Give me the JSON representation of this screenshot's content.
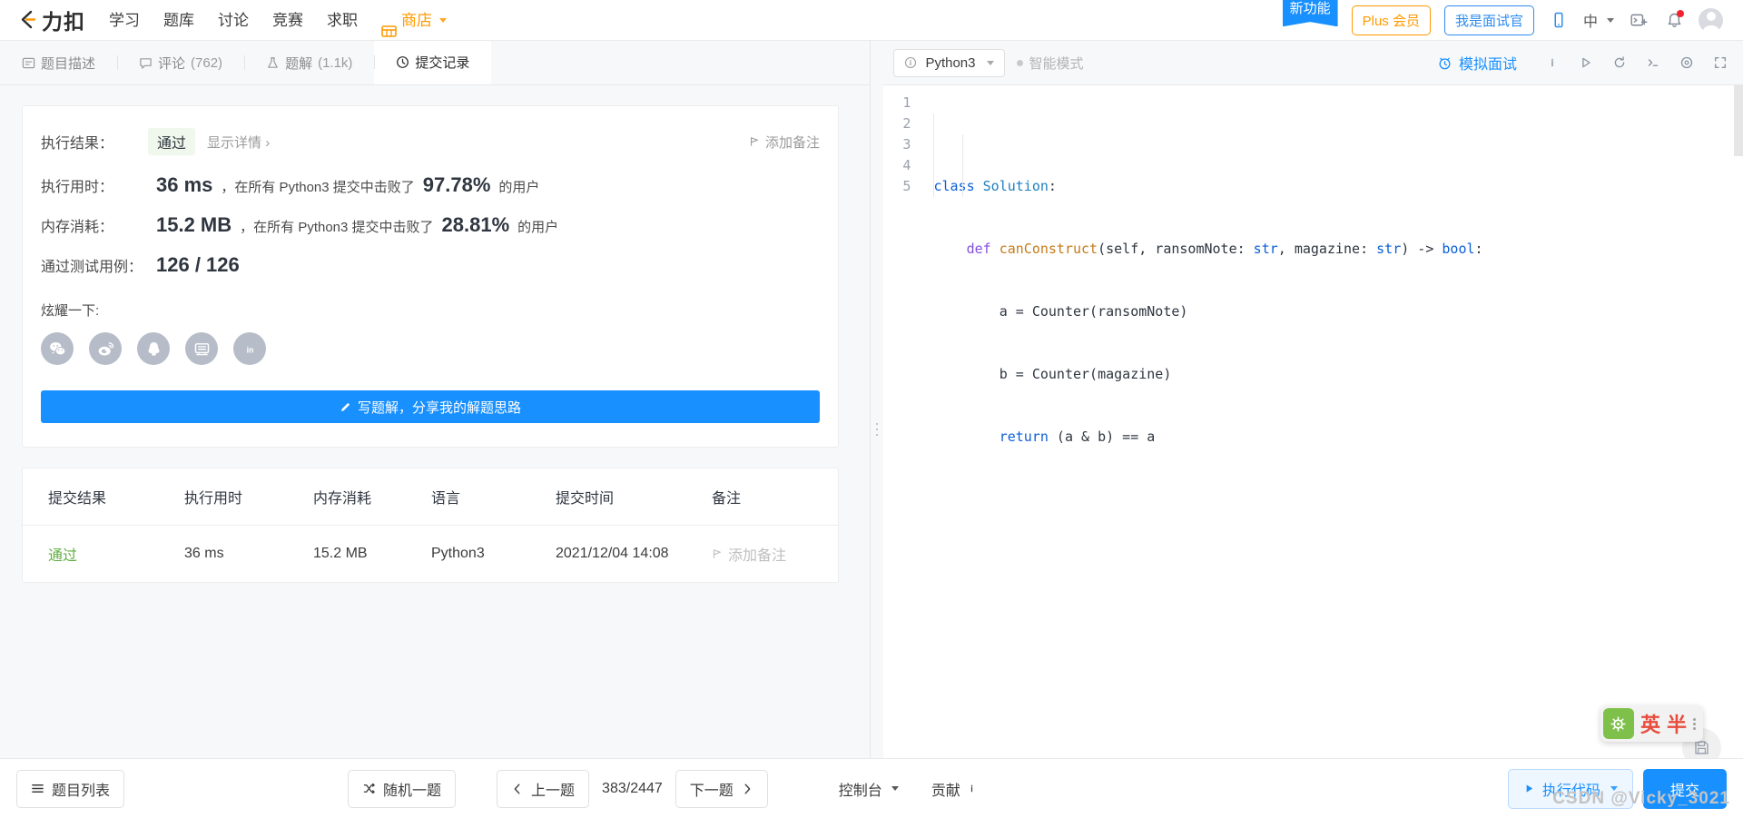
{
  "nav": {
    "brand": "力扣",
    "links": [
      "学习",
      "题库",
      "讨论",
      "竞赛",
      "求职"
    ],
    "shop": "商店",
    "ribbon": "新功能",
    "plus": "Plus 会员",
    "interviewer": "我是面试官",
    "lang": "中",
    "icons": {
      "mobile": "mobile-icon",
      "terminal": "terminal-add-icon",
      "bell": "notification-bell-icon",
      "avatar": "user-avatar"
    }
  },
  "tabs": [
    {
      "label": "题目描述",
      "count": "",
      "icon": "description-icon",
      "active": false
    },
    {
      "label": "评论",
      "count": "(762)",
      "icon": "comment-icon",
      "active": false
    },
    {
      "label": "题解",
      "count": "(1.1k)",
      "icon": "flask-icon",
      "active": false
    },
    {
      "label": "提交记录",
      "count": "",
      "icon": "clock-icon",
      "active": true
    }
  ],
  "result": {
    "exec_label": "执行结果：",
    "status": "通过",
    "detail_link": "显示详情",
    "add_note": "添加备注",
    "runtime_label": "执行用时：",
    "runtime_value": "36 ms",
    "runtime_mid": "，在所有 Python3 提交中击败了",
    "runtime_percent": "97.78%",
    "runtime_suffix": "的用户",
    "memory_label": "内存消耗：",
    "memory_value": "15.2 MB",
    "memory_mid": "，在所有 Python3 提交中击败了",
    "memory_percent": "28.81%",
    "memory_suffix": "的用户",
    "cases_label": "通过测试用例：",
    "cases_value": "126 / 126",
    "share_label": "炫耀一下:",
    "share_icons": [
      "wechat-icon",
      "weibo-icon",
      "qq-icon",
      "qzone-icon",
      "linkedin-icon"
    ],
    "write_solution": "写题解，分享我的解题思路"
  },
  "table": {
    "headers": [
      "提交结果",
      "执行用时",
      "内存消耗",
      "语言",
      "提交时间",
      "备注"
    ],
    "rows": [
      {
        "status": "通过",
        "runtime": "36 ms",
        "memory": "15.2 MB",
        "language": "Python3",
        "date": "2021/12/04 14:08",
        "note": "添加备注"
      }
    ]
  },
  "editor": {
    "language": "Python3",
    "smart_mode": "智能模式",
    "mock_interview": "模拟面试",
    "tool_icons": [
      "info-icon",
      "run-icon",
      "reset-icon",
      "console-icon",
      "settings-icon",
      "fullscreen-icon"
    ],
    "save_icon": "save-icon",
    "code_lines": [
      {
        "n": "1",
        "text": "class Solution:"
      },
      {
        "n": "2",
        "text": "    def canConstruct(self, ransomNote: str, magazine: str) -> bool:"
      },
      {
        "n": "3",
        "text": "        a = Counter(ransomNote)"
      },
      {
        "n": "4",
        "text": "        b = Counter(magazine)"
      },
      {
        "n": "5",
        "text": "        return (a & b) == a"
      }
    ]
  },
  "bottom": {
    "problem_list": "题目列表",
    "random": "随机一题",
    "prev": "上一题",
    "pager": "383/2447",
    "next": "下一题",
    "console": "控制台",
    "contribute": "贡献",
    "run_code": "执行代码",
    "submit": "提交"
  },
  "ime": {
    "mode": "英",
    "half": "半"
  },
  "watermark": "CSDN @Vicky_3021",
  "colors": {
    "primary": "#1890ff",
    "orange": "#f90",
    "pass_green": "#5faf40"
  }
}
